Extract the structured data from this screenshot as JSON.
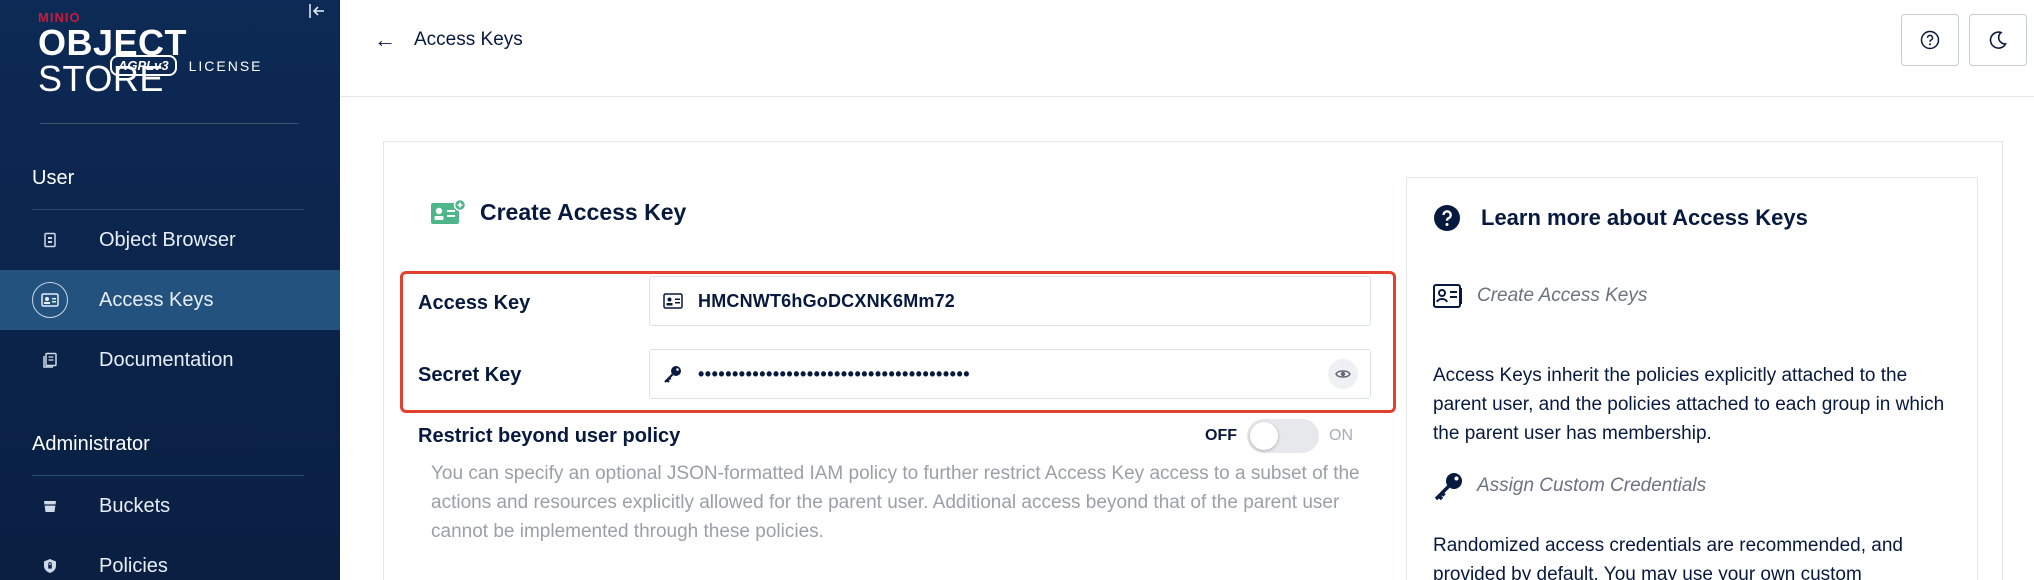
{
  "sidebar": {
    "brand_minio": "MINIO",
    "brand_object": "OBJECT",
    "brand_store": " STORE",
    "brand_agpl": "AGPLv3",
    "brand_license": "LICENSE",
    "sections": [
      {
        "title": "User",
        "items": [
          {
            "label": "Object Browser",
            "icon": "object-browser-icon"
          },
          {
            "label": "Access Keys",
            "icon": "access-keys-icon",
            "active": true
          },
          {
            "label": "Documentation",
            "icon": "documentation-icon"
          }
        ]
      },
      {
        "title": "Administrator",
        "items": [
          {
            "label": "Buckets",
            "icon": "buckets-icon"
          },
          {
            "label": "Policies",
            "icon": "policies-icon"
          }
        ]
      }
    ]
  },
  "header": {
    "back_arrow": "←",
    "title": "Access Keys"
  },
  "form": {
    "title": "Create Access Key",
    "access_key_label": "Access Key",
    "access_key_value": "HMCNWT6hGoDCXNK6Mm72",
    "secret_key_label": "Secret Key",
    "secret_key_value": "••••••••••••••••••••••••••••••••••••••••",
    "restrict_label": "Restrict beyond user policy",
    "toggle_off": "OFF",
    "toggle_on": "ON",
    "toggle_state": "off",
    "restrict_desc": "You can specify an optional JSON-formatted IAM policy to further restrict Access Key access to a subset of the actions and resources explicitly allowed for the parent user. Additional access beyond that of the parent user cannot be implemented through these policies."
  },
  "help": {
    "title": "Learn more about Access Keys",
    "create_heading": "Create Access Keys",
    "create_text": "Access Keys inherit the policies explicitly attached to the parent user, and the policies attached to each group in which the parent user has membership.",
    "assign_heading": "Assign Custom Credentials",
    "assign_text": "Randomized access credentials are recommended, and provided by default. You may use your own custom"
  },
  "colors": {
    "sidebar_bg": "#0c2a55",
    "active_item": "#24527f",
    "highlight_border": "#e2412d",
    "text_primary": "#07193e",
    "brand_red": "#c51c3f"
  }
}
